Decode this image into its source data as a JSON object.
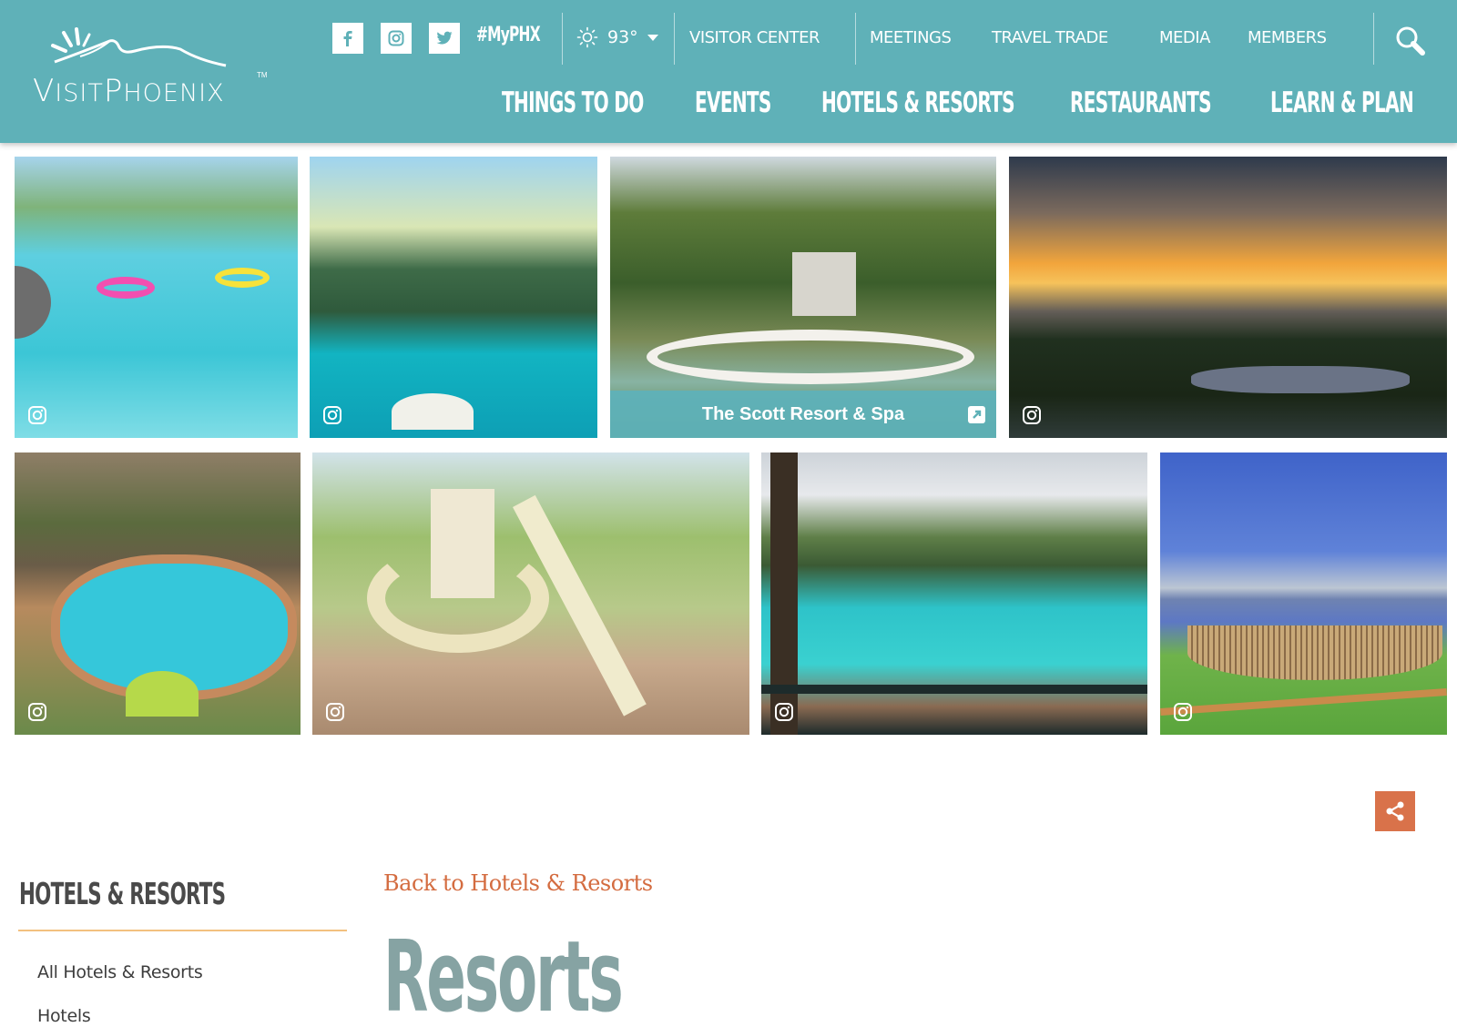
{
  "brand": {
    "logo_text_prefix": "Visit",
    "logo_text_main": "Phoenix",
    "trademark": "TM"
  },
  "header": {
    "social": [
      {
        "name": "facebook",
        "icon": "facebook-icon"
      },
      {
        "name": "instagram",
        "icon": "instagram-icon"
      },
      {
        "name": "twitter",
        "icon": "twitter-icon"
      }
    ],
    "hashtag": "#MyPHX",
    "weather": {
      "icon": "sun-icon",
      "temperature": "93°"
    },
    "utility_links": [
      "VISITOR CENTER",
      "MEETINGS",
      "TRAVEL TRADE",
      "MEDIA",
      "MEMBERS"
    ],
    "search_icon": "search-icon",
    "main_nav": [
      "THINGS TO DO",
      "EVENTS",
      "HOTELS & RESORTS",
      "RESTAURANTS",
      "LEARN & PLAN"
    ],
    "colors": {
      "bar": "#5fb1b8",
      "text": "#ffffff"
    }
  },
  "gallery": {
    "photos": [
      {
        "scene": "lazy river pool with floats",
        "badge": "instagram-icon"
      },
      {
        "scene": "palm trees and pool at sunset",
        "badge": "instagram-icon"
      },
      {
        "scene": "resort garden courtyard",
        "caption": "The Scott Resort & Spa",
        "badge": "external-link-icon"
      },
      {
        "scene": "desert sunset over water",
        "badge": "instagram-icon"
      },
      {
        "scene": "pool at mountainside resort",
        "badge": "instagram-icon"
      },
      {
        "scene": "water slide tower",
        "badge": "instagram-icon"
      },
      {
        "scene": "resort pool with cabanas",
        "badge": "instagram-icon"
      },
      {
        "scene": "hammocks by lake",
        "badge": "instagram-icon"
      }
    ]
  },
  "share": {
    "icon": "share-icon",
    "color": "#d9724a"
  },
  "sidebar": {
    "title": "HOTELS & RESORTS",
    "items": [
      "All Hotels & Resorts",
      "Hotels"
    ],
    "rule_color": "#f3c07f"
  },
  "content": {
    "back_link": "Back to Hotels & Resorts",
    "page_title": "Resorts",
    "colors": {
      "back_link": "#d46c40",
      "title": "#86a3a3"
    }
  }
}
